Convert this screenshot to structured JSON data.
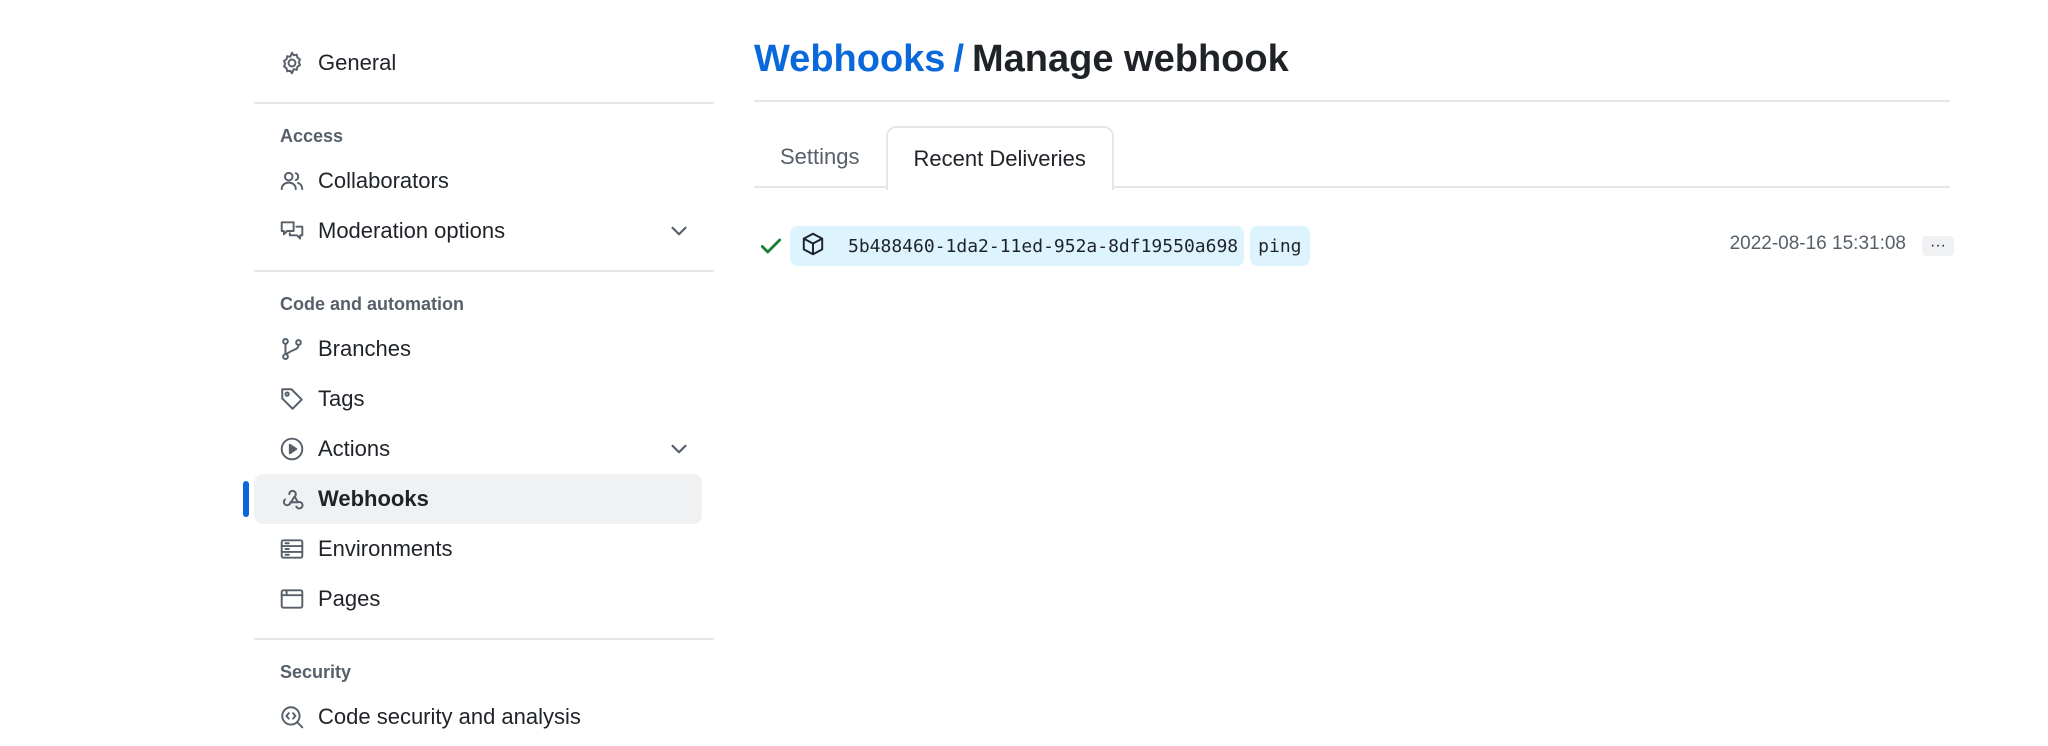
{
  "sidebar": {
    "general": "General",
    "sections": [
      {
        "title": "Access",
        "items": [
          {
            "label": "Collaborators",
            "icon": "people-icon"
          },
          {
            "label": "Moderation options",
            "icon": "comment-discussion-icon",
            "expandable": true
          }
        ]
      },
      {
        "title": "Code and automation",
        "items": [
          {
            "label": "Branches",
            "icon": "git-branch-icon"
          },
          {
            "label": "Tags",
            "icon": "tag-icon"
          },
          {
            "label": "Actions",
            "icon": "play-icon",
            "expandable": true
          },
          {
            "label": "Webhooks",
            "icon": "webhook-icon",
            "active": true
          },
          {
            "label": "Environments",
            "icon": "server-icon"
          },
          {
            "label": "Pages",
            "icon": "browser-icon"
          }
        ]
      },
      {
        "title": "Security",
        "items": [
          {
            "label": "Code security and analysis",
            "icon": "codescan-icon"
          }
        ]
      }
    ]
  },
  "header": {
    "breadcrumb": "Webhooks",
    "separator": "/",
    "title": "Manage webhook"
  },
  "tabs": [
    {
      "label": "Settings",
      "selected": false
    },
    {
      "label": "Recent Deliveries",
      "selected": true
    }
  ],
  "deliveries": [
    {
      "status": "success",
      "guid": "5b488460-1da2-11ed-952a-8df19550a698",
      "event": "ping",
      "timestamp": "2022-08-16 15:31:08",
      "more_label": "···"
    }
  ],
  "colors": {
    "accent": "#0969da",
    "success": "#1a7f37",
    "pill_bg": "#ddf4ff",
    "muted": "#57606a"
  }
}
